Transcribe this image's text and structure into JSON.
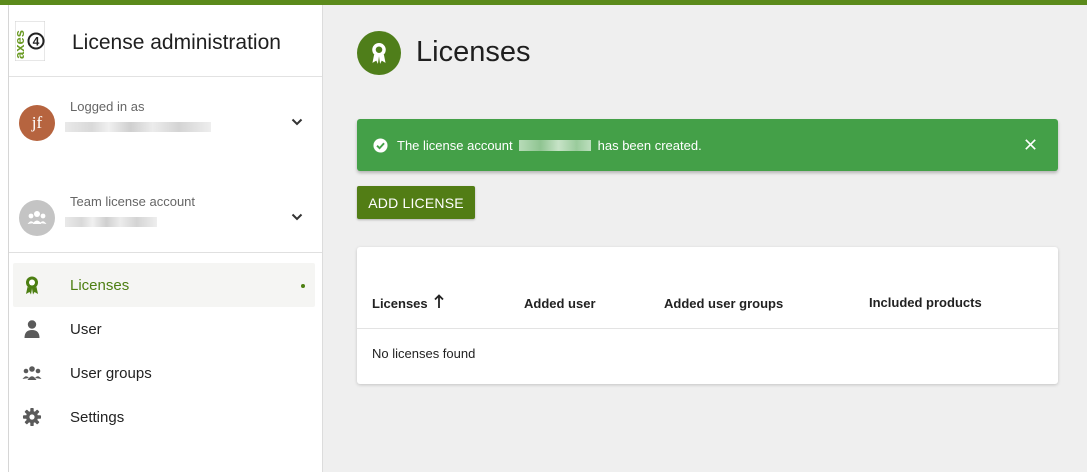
{
  "app": {
    "title": "License administration",
    "logo_text": "axes",
    "logo_digit": "4"
  },
  "sidebar": {
    "user_account": {
      "avatar_initials": "jf",
      "label": "Logged in as"
    },
    "team_account": {
      "label": "Team license account"
    },
    "nav": [
      {
        "label": "Licenses",
        "icon": "award-icon",
        "active": true
      },
      {
        "label": "User",
        "icon": "user-icon",
        "active": false
      },
      {
        "label": "User groups",
        "icon": "user-groups-icon",
        "active": false
      },
      {
        "label": "Settings",
        "icon": "gear-icon",
        "active": false
      }
    ]
  },
  "main": {
    "page_title": "Licenses",
    "alert": {
      "prefix": "The license account",
      "suffix": "has been created.",
      "type": "success"
    },
    "add_button": "ADD LICENSE",
    "table": {
      "columns": [
        "Licenses",
        "Added user",
        "Added user groups",
        "Included products"
      ],
      "sorted_column": "Licenses",
      "sort_direction": "ascending",
      "empty_message": "No licenses found"
    }
  },
  "colors": {
    "brand_green": "#527d15",
    "success_green": "#44a048",
    "top_bar": "#5b8a1b",
    "user_avatar": "#b6643f"
  }
}
